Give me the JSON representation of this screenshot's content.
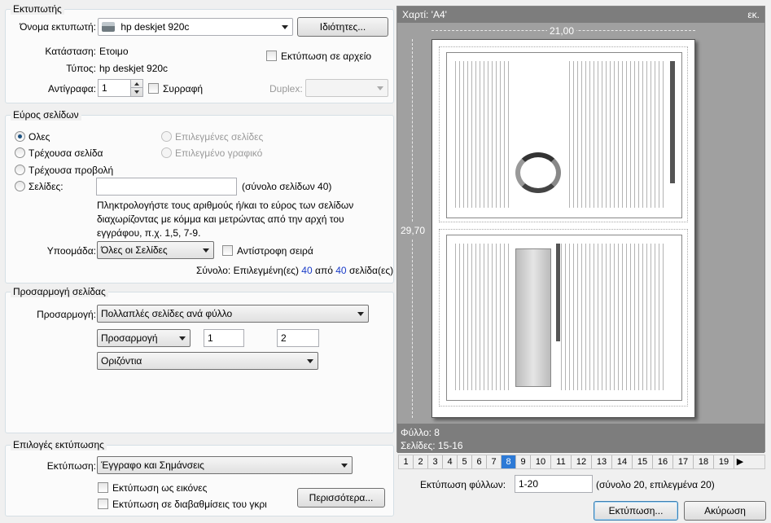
{
  "printer": {
    "group_title": "Εκτυπωτής",
    "name_label": "Όνομα εκτυπωτή:",
    "name_value": "hp deskjet 920c",
    "properties_button": "Ιδιότητες...",
    "status_label": "Κατάσταση:",
    "status_value": "Ετοιμο",
    "type_label": "Τύπος:",
    "type_value": "hp deskjet 920c",
    "print_to_file": "Εκτύπωση σε αρχείο",
    "copies_label": "Αντίγραφα:",
    "copies_value": "1",
    "collate": "Συρραφή",
    "duplex_label": "Duplex:",
    "duplex_value": ""
  },
  "range": {
    "group_title": "Εύρος σελίδων",
    "all": "Ολες",
    "current_page": "Τρέχουσα σελίδα",
    "current_view": "Τρέχουσα προβολή",
    "pages": "Σελίδες:",
    "pages_value": "",
    "total_pages": "(σύνολο σελίδων 40)",
    "selected_pages": "Επιλεγμένες σελίδες",
    "selected_graphic": "Επιλεγμένο γραφικό",
    "help_line1": "Πληκτρολογήστε τους αριθμούς ή/και το εύρος των σελίδων",
    "help_line2": "διαχωρίζοντας με κόμμα και μετρώντας από την αρχή του",
    "help_line3": "εγγράφου, π.χ. 1,5, 7-9.",
    "subset_label": "Υποομάδα:",
    "subset_value": "Όλες οι Σελίδες",
    "reverse": "Αντίστροφη σειρά",
    "summary_prefix": "Σύνολο: Επιλεγμένη(ες)",
    "summary_selected": "40",
    "summary_mid": "από",
    "summary_total": "40",
    "summary_suffix": "σελίδα(ες)"
  },
  "fit": {
    "group_title": "Προσαρμογή σελίδας",
    "fit_label": "Προσαρμογή:",
    "fit_value": "Πολλαπλές σελίδες ανά φύλλο",
    "sub_value": "Προσαρμογή",
    "cols_value": "1",
    "rows_value": "2",
    "orientation_value": "Οριζόντια"
  },
  "options": {
    "group_title": "Επιλογές εκτύπωσης",
    "print_label": "Εκτύπωση:",
    "print_value": "Έγγραφο και Σημάνσεις",
    "as_image": "Εκτύπωση ως εικόνες",
    "grayscale": "Εκτύπωση σε διαβαθμίσεις του γκρι",
    "more_button": "Περισσότερα..."
  },
  "preview": {
    "paper_label": "Χαρτί: 'A4'",
    "unit": "εκ.",
    "width_value": "21,00",
    "height_value": "29,70",
    "sheet_label": "Φύλλο: 8",
    "pages_label": "Σελίδες: 15-16"
  },
  "pager": {
    "pages": [
      "1",
      "2",
      "3",
      "4",
      "5",
      "6",
      "7",
      "8",
      "9",
      "10",
      "11",
      "12",
      "13",
      "14",
      "15",
      "16",
      "17",
      "18",
      "19"
    ],
    "selected_index": 7,
    "next_arrow": "▶"
  },
  "sheets": {
    "label": "Εκτύπωση φύλλων:",
    "value": "1-20",
    "summary": "(σύνολο 20, επιλεγμένα 20)"
  },
  "buttons": {
    "print": "Εκτύπωση...",
    "cancel": "Ακύρωση"
  },
  "colors": {
    "accent": "#2d7ad6",
    "summary_number": "#1a3cc8",
    "preview_bg": "#a0a0a0",
    "preview_bar": "#7d7d7d"
  }
}
